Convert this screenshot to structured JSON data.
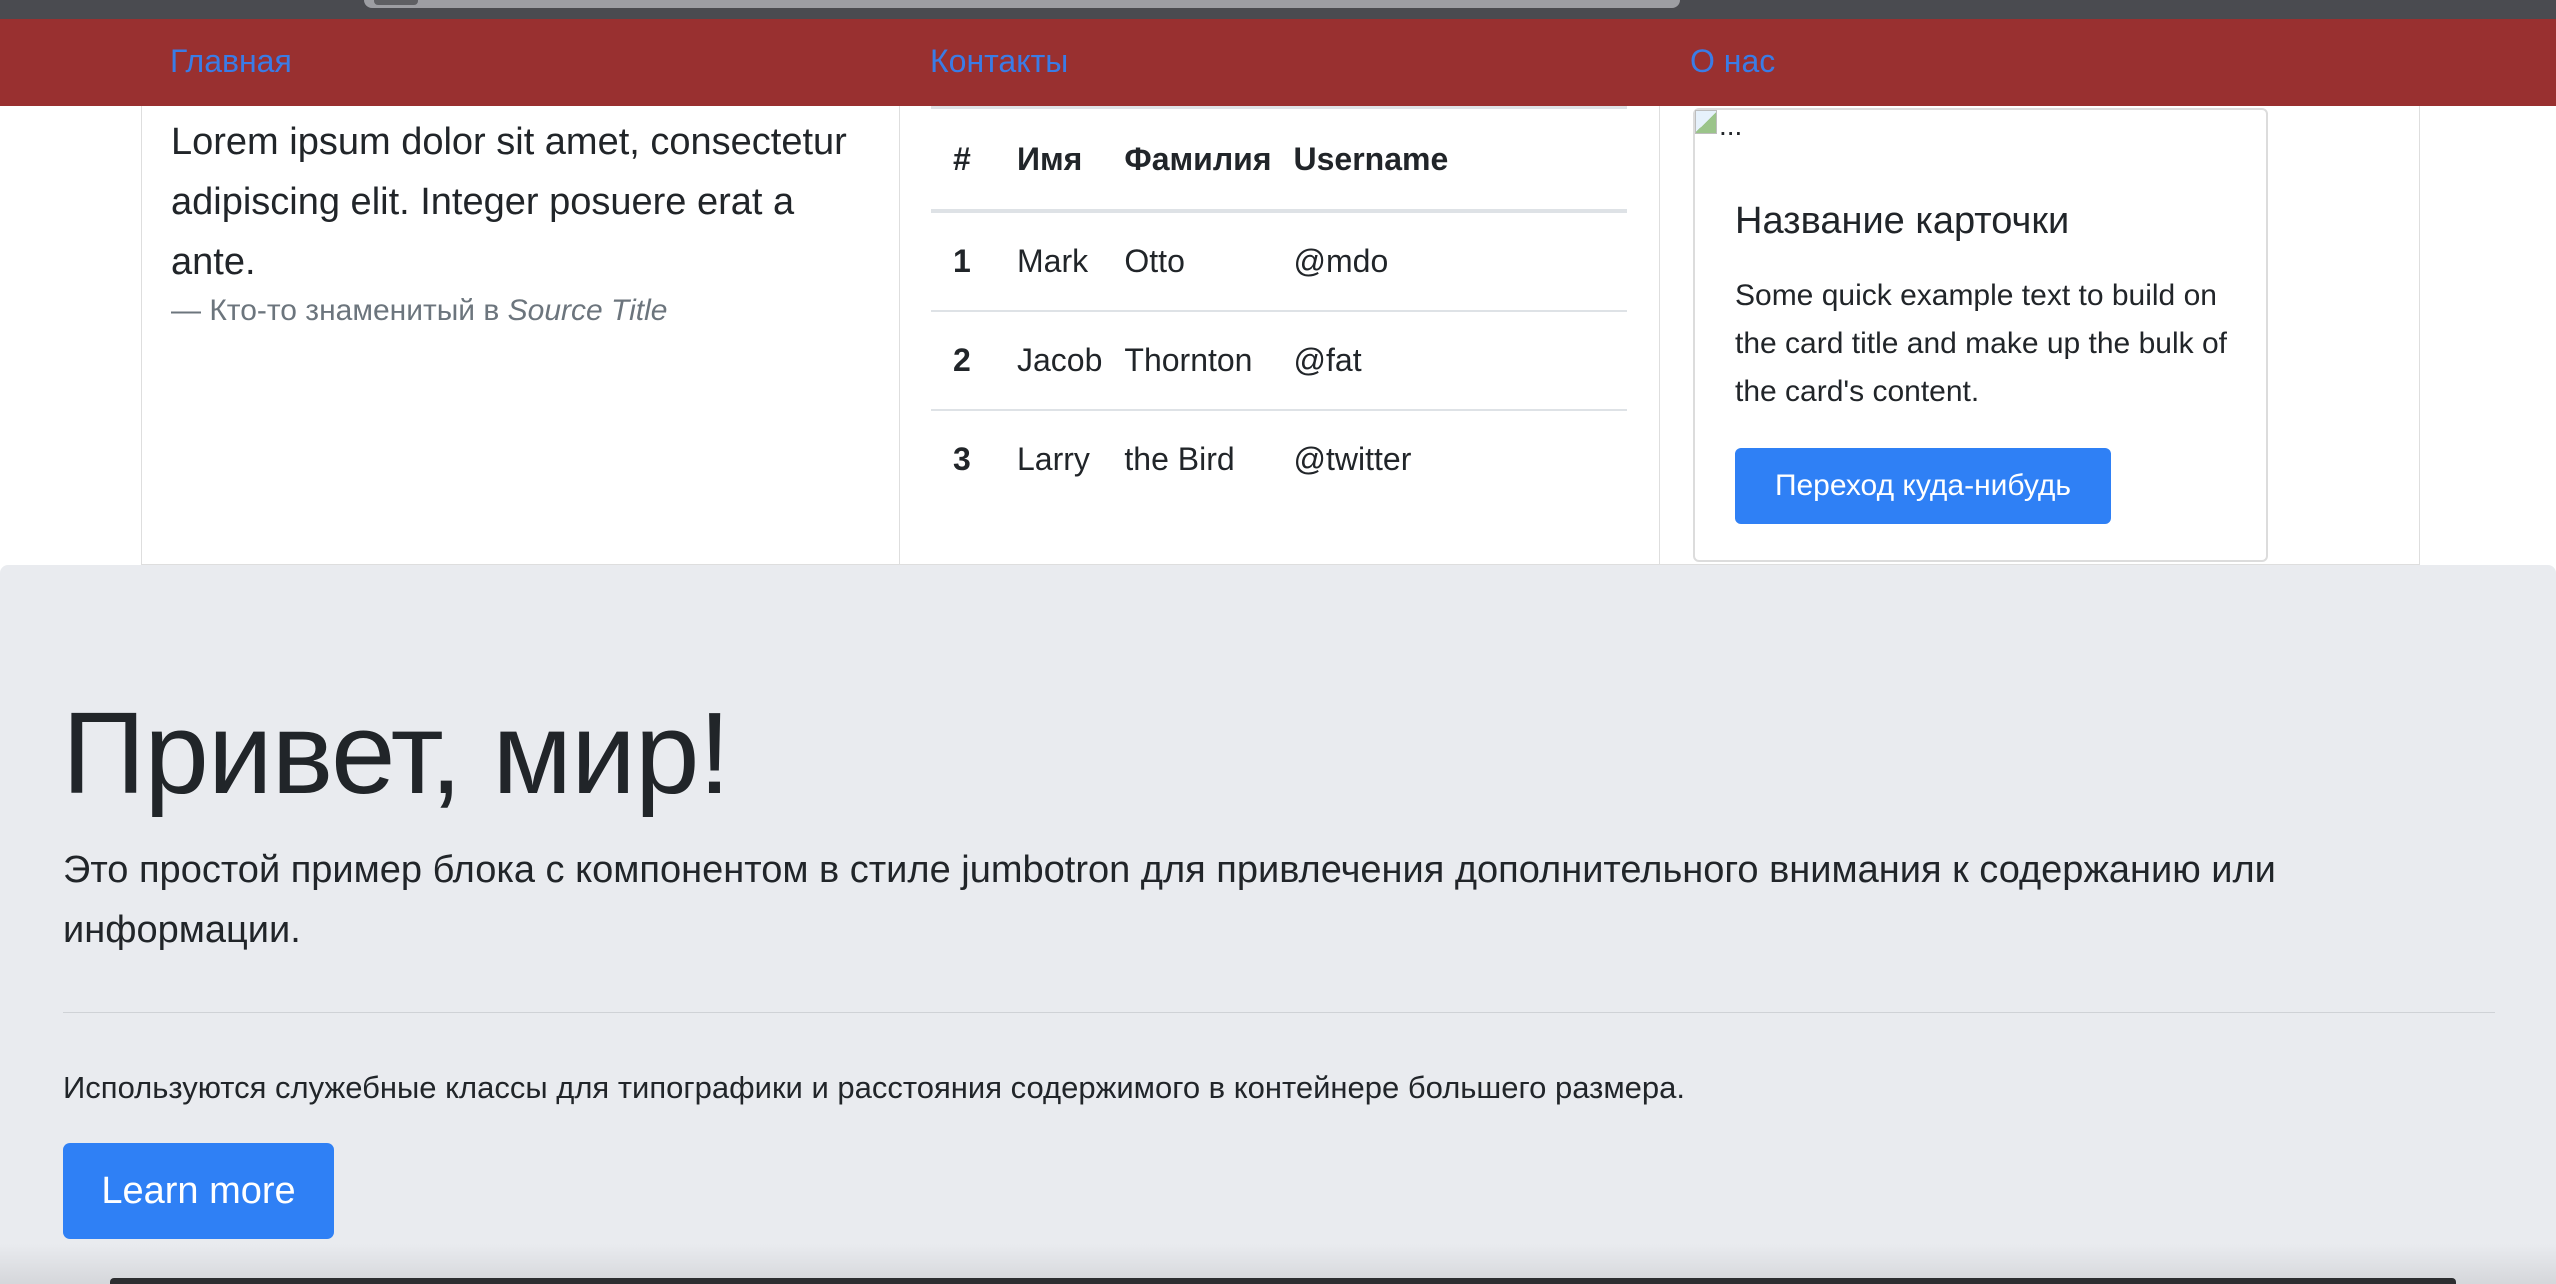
{
  "nav": {
    "home": "Главная",
    "contacts": "Контакты",
    "about": "О нас"
  },
  "quote": {
    "text": "Lorem ipsum dolor sit amet, consectetur adipiscing elit. Integer posuere erat a ante.",
    "footer_prefix": "— Кто-то знаменитый в",
    "source_title": "Source Title"
  },
  "table": {
    "headers": [
      "#",
      "Имя",
      "Фамилия",
      "Username"
    ],
    "rows": [
      [
        "1",
        "Mark",
        "Otto",
        "@mdo"
      ],
      [
        "2",
        "Jacob",
        "Thornton",
        "@fat"
      ],
      [
        "3",
        "Larry",
        "the Bird",
        "@twitter"
      ]
    ]
  },
  "card": {
    "img_alt": "...",
    "title": "Название карточки",
    "text": "Some quick example text to build on the card title and make up the bulk of the card's content.",
    "button": "Переход куда-нибудь"
  },
  "jumbotron": {
    "title": "Привет, мир!",
    "lead": "Это простой пример блока с компонентом в стиле jumbotron для привлечения дополнительного внимания к содержанию или информации.",
    "text": "Используются служебные классы для типографики и расстояния содержимого в контейнере большего размера.",
    "button": "Learn more"
  },
  "colors": {
    "navbar_bg": "#993030",
    "nav_link": "#3a7ce6",
    "primary_button": "#2f80f5",
    "jumbotron_bg": "#e9ebef"
  }
}
